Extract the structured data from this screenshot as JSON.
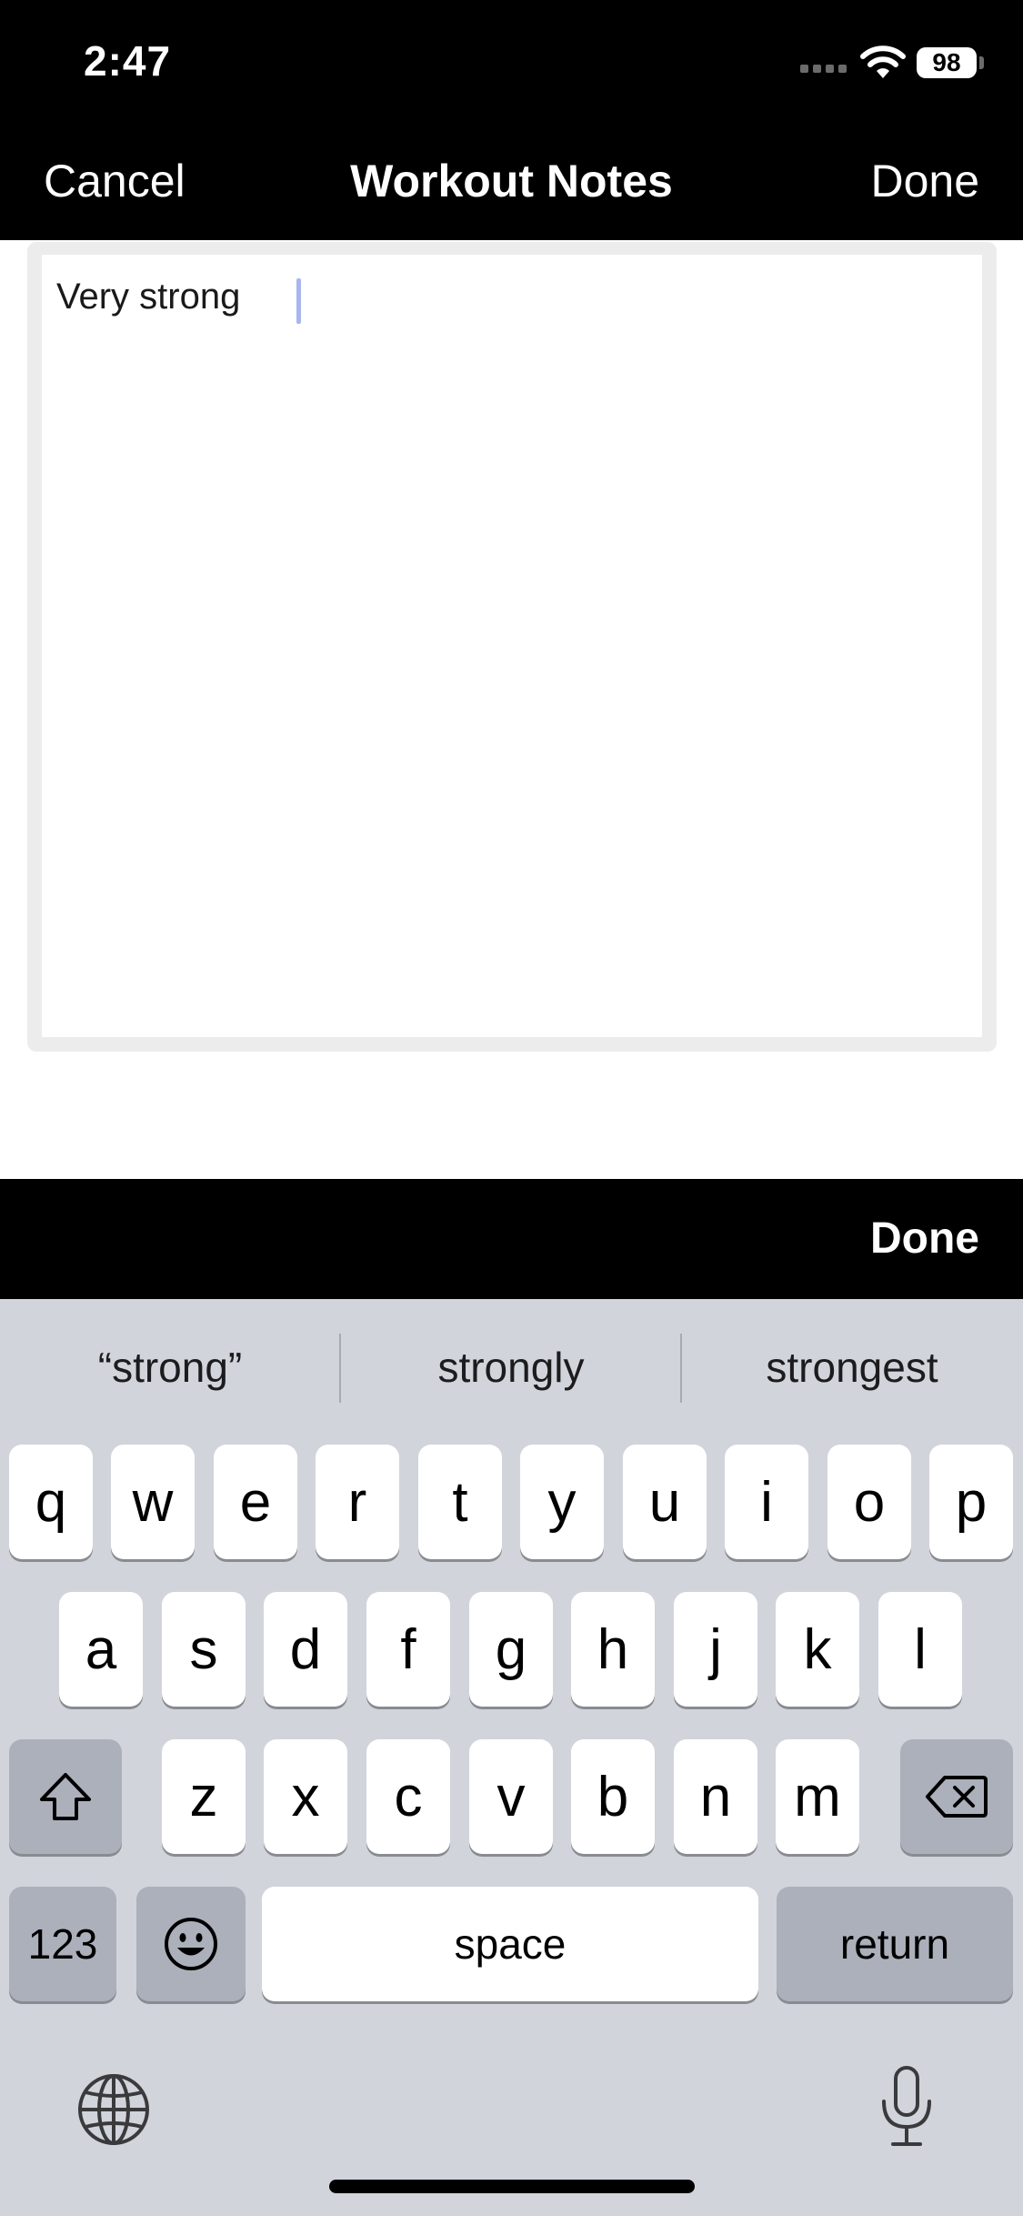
{
  "status_bar": {
    "time": "2:47",
    "battery": "98",
    "signal_icon": "cellular-signal-icon",
    "wifi_icon": "wifi-icon"
  },
  "nav_bar": {
    "cancel_label": "Cancel",
    "title": "Workout Notes",
    "done_label": "Done"
  },
  "notes": {
    "value": "Very strong"
  },
  "keyboard_toolbar": {
    "done_label": "Done"
  },
  "keyboard": {
    "predictions": [
      "“strong”",
      "strongly",
      "strongest"
    ],
    "row1": [
      "q",
      "w",
      "e",
      "r",
      "t",
      "y",
      "u",
      "i",
      "o",
      "p"
    ],
    "row2": [
      "a",
      "s",
      "d",
      "f",
      "g",
      "h",
      "j",
      "k",
      "l"
    ],
    "row3": [
      "z",
      "x",
      "c",
      "v",
      "b",
      "n",
      "m"
    ],
    "numbers_label": "123",
    "space_label": "space",
    "return_label": "return",
    "icons": {
      "shift": "shift-icon",
      "delete": "backspace-icon",
      "emoji": "emoji-icon",
      "globe": "globe-icon",
      "mic": "microphone-icon"
    }
  },
  "colors": {
    "bar_background": "#000000",
    "keyboard_background": "#d1d4db",
    "dark_key": "#abb0bb",
    "cursor": "#a8b6ee"
  }
}
